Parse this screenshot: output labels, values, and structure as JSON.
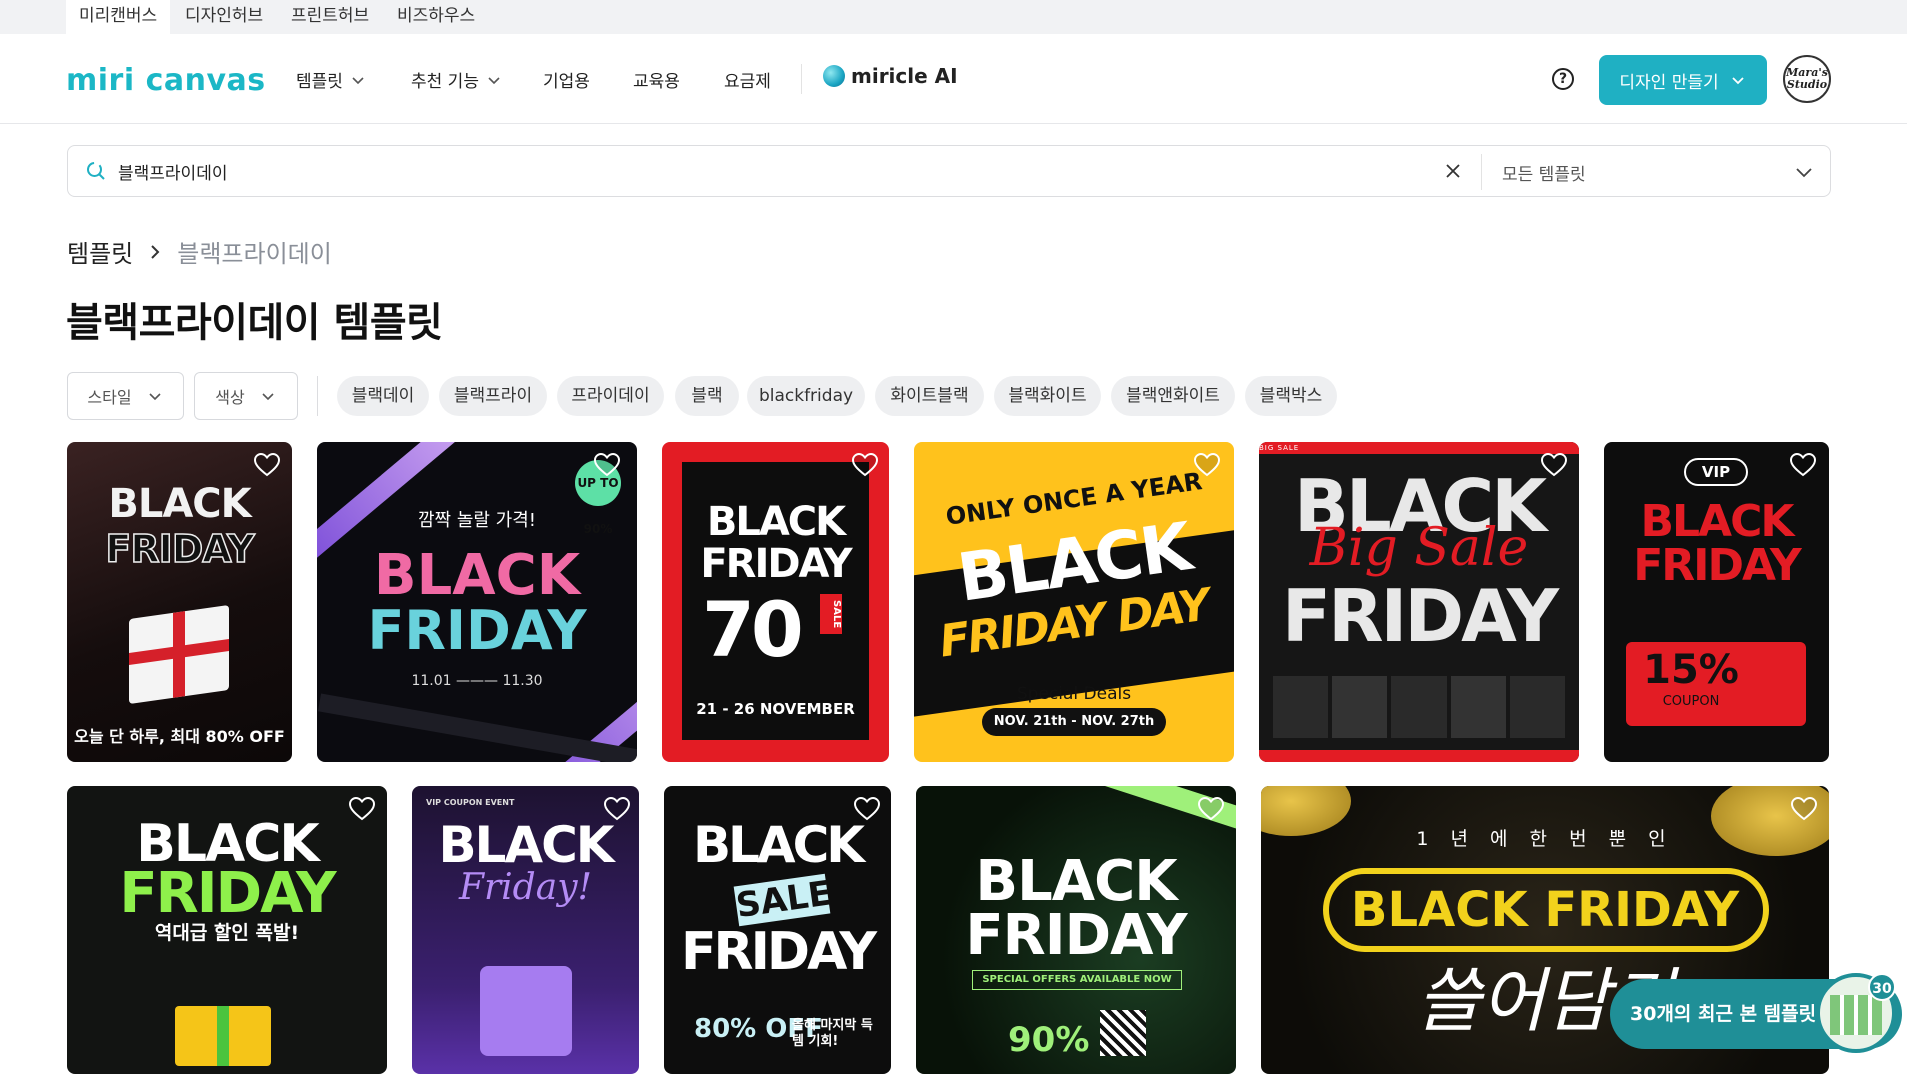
{
  "service_tabs": [
    "미리캔버스",
    "디자인허브",
    "프린트허브",
    "비즈하우스"
  ],
  "header": {
    "logo": "miri canvas",
    "nav": [
      "템플릿",
      "추천 기능",
      "기업용",
      "교육용",
      "요금제"
    ],
    "ai_label": "miricle AI",
    "help": "?",
    "make_button": "디자인 만들기",
    "avatar_text": "Mara's Studio"
  },
  "search": {
    "value": "블랙프라이데이",
    "scope": "모든 템플릿"
  },
  "breadcrumb": {
    "root": "템플릿",
    "current": "블랙프라이데이"
  },
  "page_title": "블랙프라이데이 템플릿",
  "filters": {
    "style": "스타일",
    "color": "색상"
  },
  "chips": [
    "블랙데이",
    "블랙프라이",
    "프라이데이",
    "블랙",
    "blackfriday",
    "화이트블랙",
    "블랙화이트",
    "블랙앤화이트",
    "블랙박스"
  ],
  "cards": [
    {
      "l1": "BLACK",
      "l2": "FRIDAY",
      "sub": "오늘 단 하루, 최대 80% OFF"
    },
    {
      "l1": "BLACK",
      "l2": "FRIDAY",
      "top": "깜짝 놀랄 가격!",
      "badge": "UP TO 90%",
      "dates": "11.01 ——— 11.30"
    },
    {
      "l1": "BLACK",
      "l2": "FRIDAY",
      "big": "70",
      "side": "SALE",
      "sub": "21 - 26 NOVEMBER"
    },
    {
      "top": "ONLY ONCE A YEAR",
      "l1": "BLACK",
      "l2": "FRIDAY DAY",
      "sub": "Special Deals",
      "date": "NOV. 21th - NOV. 27th"
    },
    {
      "l1": "BLACK",
      "mid": "Big Sale",
      "l2": "FRIDAY",
      "banner": "BIG SALE"
    },
    {
      "vip": "VIP",
      "l1": "BLACK",
      "l2": "FRIDAY",
      "coupon": "15%",
      "coupon_sub": "COUPON"
    },
    {
      "l1": "BLACK",
      "l2": "FRIDAY",
      "sub": "역대급 할인 폭발!"
    },
    {
      "l1": "BLACK",
      "script": "Friday!",
      "tag": "VIP COUPON EVENT"
    },
    {
      "l1": "BLACK",
      "sale": "SALE",
      "l2": "FRIDAY",
      "sub": "80% OFF",
      "kor": "올해 마지막 득템 기회!"
    },
    {
      "l1": "BLACK",
      "l2": "FRIDAY",
      "sub": "SPECIAL OFFERS AVAILABLE NOW",
      "disc": "90%"
    },
    {
      "top": "1 년 에 한 번 뿐 인",
      "l1": "BLACK FRIDAY",
      "script": "쓸어담기"
    }
  ],
  "recent": {
    "label": "30개의 최근 본 템플릿",
    "count": "30"
  },
  "colors": {
    "accent": "#1fb0c3",
    "brand": "#1bb7c6"
  }
}
